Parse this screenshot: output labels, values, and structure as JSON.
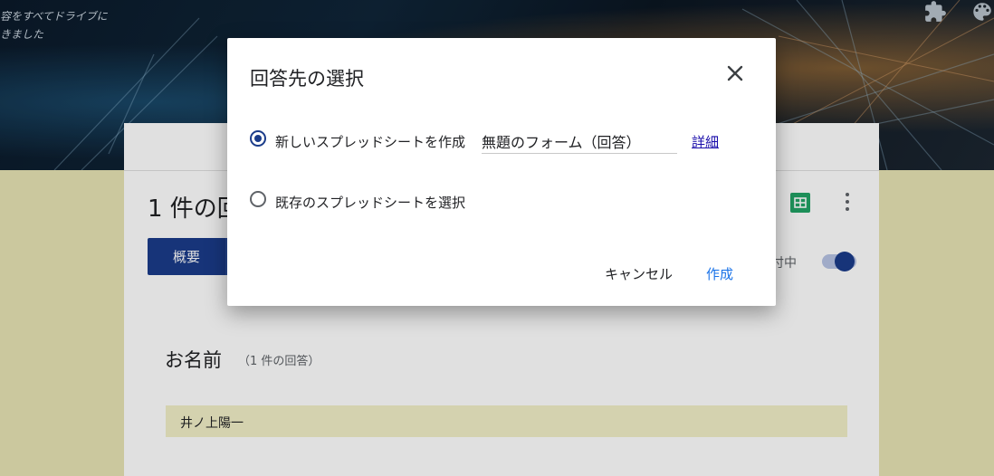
{
  "banner": {
    "text": "容をすべてドライブに\nきました",
    "icons": [
      "puzzle-icon",
      "palette-icon"
    ]
  },
  "responses": {
    "count_title": "1 件の回",
    "tab_summary": "概要",
    "accepting_label": "付中",
    "question": {
      "title": "お名前",
      "count": "（1 件の回答）",
      "answers": [
        "井ノ上陽一"
      ]
    }
  },
  "dialog": {
    "title": "回答先の選択",
    "option_new": "新しいスプレッドシートを作成",
    "option_new_selected": true,
    "sheet_name": "無題のフォーム（回答）",
    "details_link": "詳細",
    "option_existing": "既存のスプレッドシートを選択",
    "cancel_label": "キャンセル",
    "create_label": "作成"
  },
  "colors": {
    "accent": "#1b3c8a",
    "link": "#1a0dab",
    "primary_button": "#1a73e8",
    "page_background": "#e7e4b4"
  }
}
